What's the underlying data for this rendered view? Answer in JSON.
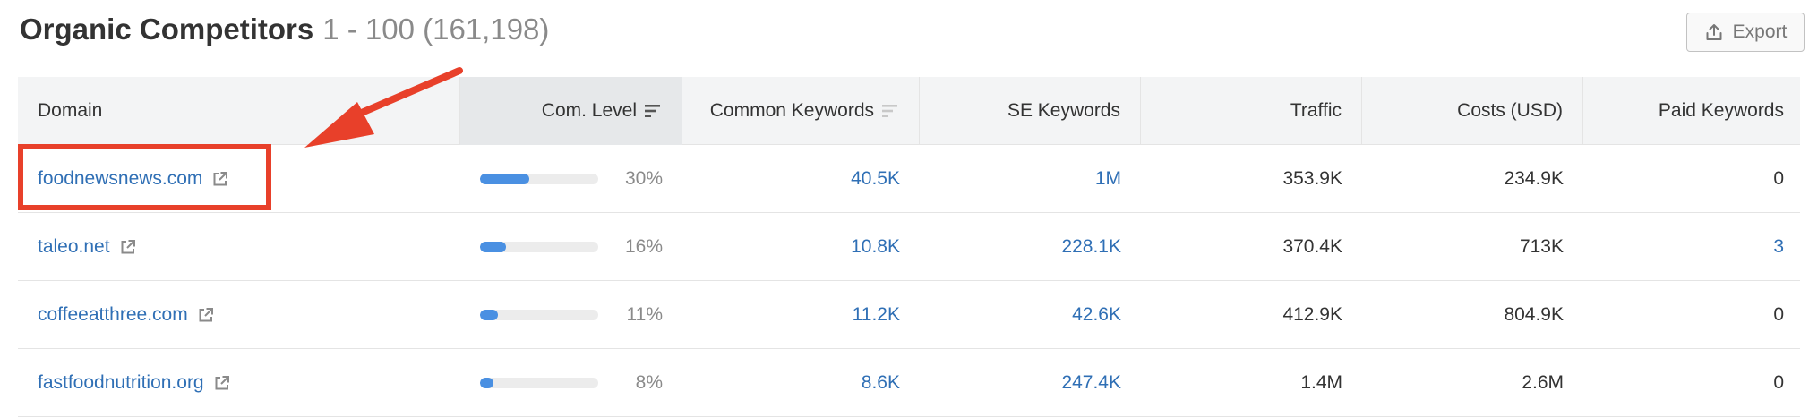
{
  "header": {
    "title": "Organic Competitors",
    "range": "1 - 100 (161,198)"
  },
  "toolbar": {
    "export_label": "Export"
  },
  "table": {
    "columns": [
      {
        "label": "Domain"
      },
      {
        "label": "Com. Level"
      },
      {
        "label": "Common Keywords"
      },
      {
        "label": "SE Keywords"
      },
      {
        "label": "Traffic"
      },
      {
        "label": "Costs (USD)"
      },
      {
        "label": "Paid Keywords"
      }
    ],
    "rows": [
      {
        "domain": "foodnewsnews.com",
        "level": 0.3,
        "level_label": "30%",
        "common": "40.5K",
        "se": "1M",
        "traffic": "353.9K",
        "costs": "234.9K",
        "paid": "0"
      },
      {
        "domain": "taleo.net",
        "level": 0.16,
        "level_label": "16%",
        "common": "10.8K",
        "se": "228.1K",
        "traffic": "370.4K",
        "costs": "713K",
        "paid": "3"
      },
      {
        "domain": "coffeeatthree.com",
        "level": 0.11,
        "level_label": "11%",
        "common": "11.2K",
        "se": "42.6K",
        "traffic": "412.9K",
        "costs": "804.9K",
        "paid": "0"
      },
      {
        "domain": "fastfoodnutrition.org",
        "level": 0.08,
        "level_label": "8%",
        "common": "8.6K",
        "se": "247.4K",
        "traffic": "1.4M",
        "costs": "2.6M",
        "paid": "0"
      }
    ]
  },
  "colors": {
    "link": "#2f6fb5",
    "bar": "#4a90e2",
    "annotation": "#e8402a"
  },
  "icons": {
    "export": "export-icon",
    "external_link": "external-link-icon",
    "sort": "sort-icon"
  }
}
